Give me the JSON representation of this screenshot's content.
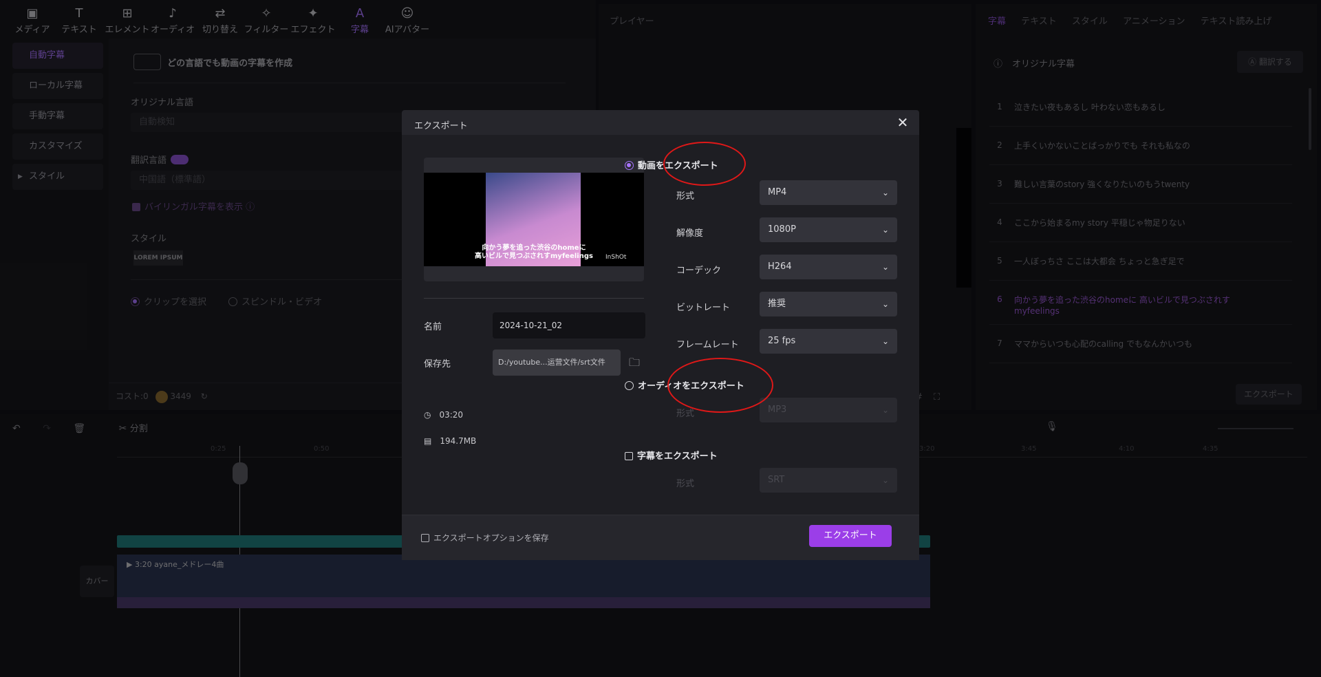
{
  "toolbar": {
    "items": [
      {
        "label": "メディア",
        "icon": "media-icon"
      },
      {
        "label": "テキスト",
        "icon": "text-icon"
      },
      {
        "label": "エレメント",
        "icon": "elements-icon"
      },
      {
        "label": "オーディオ",
        "icon": "audio-icon"
      },
      {
        "label": "切り替え",
        "icon": "transition-icon"
      },
      {
        "label": "フィルター",
        "icon": "filter-icon"
      },
      {
        "label": "エフェクト",
        "icon": "effect-icon"
      },
      {
        "label": "字幕",
        "icon": "caption-icon",
        "active": true
      },
      {
        "label": "AIアバター",
        "icon": "avatar-icon"
      }
    ]
  },
  "sidebar": {
    "items": [
      "自動字幕",
      "ローカル字幕",
      "手動字幕",
      "カスタマイズ",
      "スタイル"
    ]
  },
  "caption_panel": {
    "heading": "どの言語でも動画の字幕を作成",
    "original_language_label": "オリジナル言語",
    "original_language_value": "自動検知",
    "translate_label": "翻訳言語",
    "translate_value": "中国語（標準語）",
    "bilingual_label": "バイリンガル字幕を表示",
    "style_label": "スタイル",
    "style_sample": "LOREM IPSUM",
    "option_clip": "クリップを選択",
    "option_spindle": "スピンドル・ビデオ",
    "cost_label": "コスト:0",
    "cost_value": "3449"
  },
  "player": {
    "title": "プレイヤー"
  },
  "right_panel": {
    "tabs": [
      "字幕",
      "テキスト",
      "スタイル",
      "アニメーション",
      "テキスト読み上げ"
    ],
    "heading": "オリジナル字幕",
    "translate_button": "翻訳する",
    "export_button": "エクスポート",
    "items": [
      {
        "num": "1",
        "text": "泣きたい夜もあるし 叶わない恋もあるし"
      },
      {
        "num": "2",
        "text": "上手くいかないことばっかりでも それも私なの"
      },
      {
        "num": "3",
        "text": "難しい言葉のstory 強くなりたいのもうtwenty"
      },
      {
        "num": "4",
        "text": "ここから始まるmy story 平穏じゃ物足りない"
      },
      {
        "num": "5",
        "text": "一人ぼっちさ ここは大都会 ちょっと急ぎ足で"
      },
      {
        "num": "6",
        "text": "向かう夢を追った渋谷のhomeに 高いビルで見つぶされす myfeelings",
        "active": true
      },
      {
        "num": "7",
        "text": "ママからいつも心配のcalling でもなんかいつも"
      }
    ]
  },
  "timeline": {
    "split_label": "分割",
    "ticks": [
      "0:25",
      "0:50",
      "3:20",
      "3:45",
      "4:10",
      "4:35"
    ],
    "cover_label": "カバー",
    "clip_label": "3:20  ayane_メドレー4曲"
  },
  "dialog": {
    "title": "エクスポート",
    "preview_caption_line1": "向かう夢を追った渋谷のhomeに",
    "preview_caption_line2": "高いビルで見つぶされすmyfeelings",
    "preview_watermark": "InShOt",
    "name_label": "名前",
    "name_value": "2024-10-21_02",
    "save_label": "保存先",
    "save_value": "D:/youtube...运营文件/srt文件",
    "duration": "03:20",
    "filesize": "194.7MB",
    "video_section": "動画をエクスポート",
    "format_label": "形式",
    "format_value": "MP4",
    "resolution_label": "解像度",
    "resolution_value": "1080P",
    "codec_label": "コーデック",
    "codec_value": "H264",
    "bitrate_label": "ビットレート",
    "bitrate_value": "推奨",
    "framerate_label": "フレームレート",
    "framerate_value": "25  fps",
    "audio_section": "オーディオをエクスポート",
    "audio_format_label": "形式",
    "audio_format_value": "MP3",
    "subtitle_section": "字幕をエクスポート",
    "subtitle_format_label": "形式",
    "subtitle_format_value": "SRT",
    "save_options_label": "エクスポートオプションを保存",
    "export_button": "エクスポート"
  },
  "colors": {
    "accent": "#a874ff",
    "export_button": "#9b3ee8",
    "annotation": "#e01818",
    "track": "#1f7b7b"
  }
}
